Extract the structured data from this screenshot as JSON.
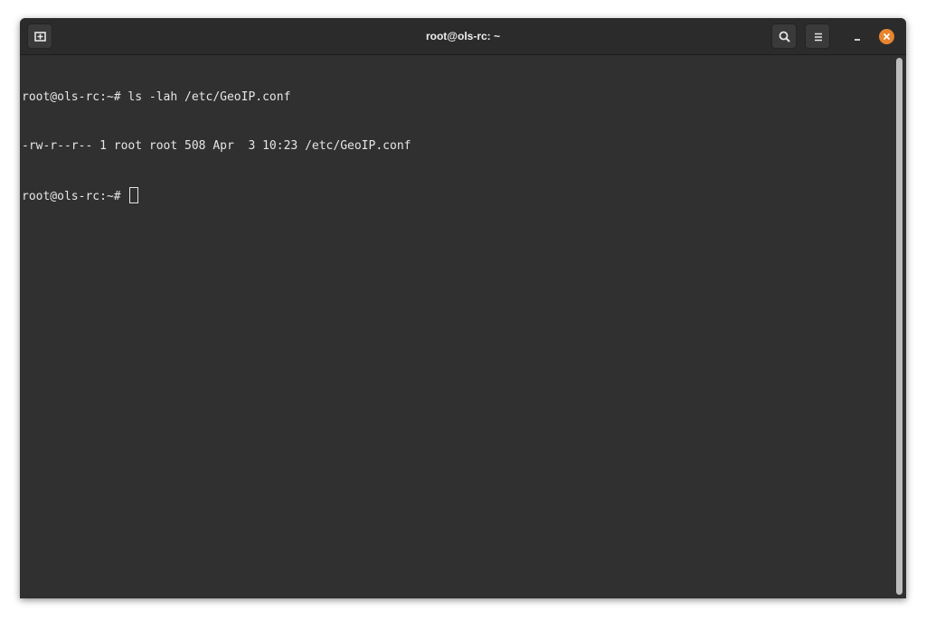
{
  "window": {
    "title": "root@ols-rc: ~"
  },
  "toolbar": {
    "new_tab_icon": "new-tab-icon",
    "search_icon": "search-icon",
    "menu_icon": "hamburger-menu-icon",
    "minimize_icon": "minimize-icon",
    "close_icon": "close-icon",
    "close_color": "#e7852f"
  },
  "terminal": {
    "background": "#303030",
    "lines": [
      "root@ols-rc:~# ls -lah /etc/GeoIP.conf",
      "-rw-r--r-- 1 root root 508 Apr  3 10:23 /etc/GeoIP.conf",
      "root@ols-rc:~# "
    ]
  }
}
